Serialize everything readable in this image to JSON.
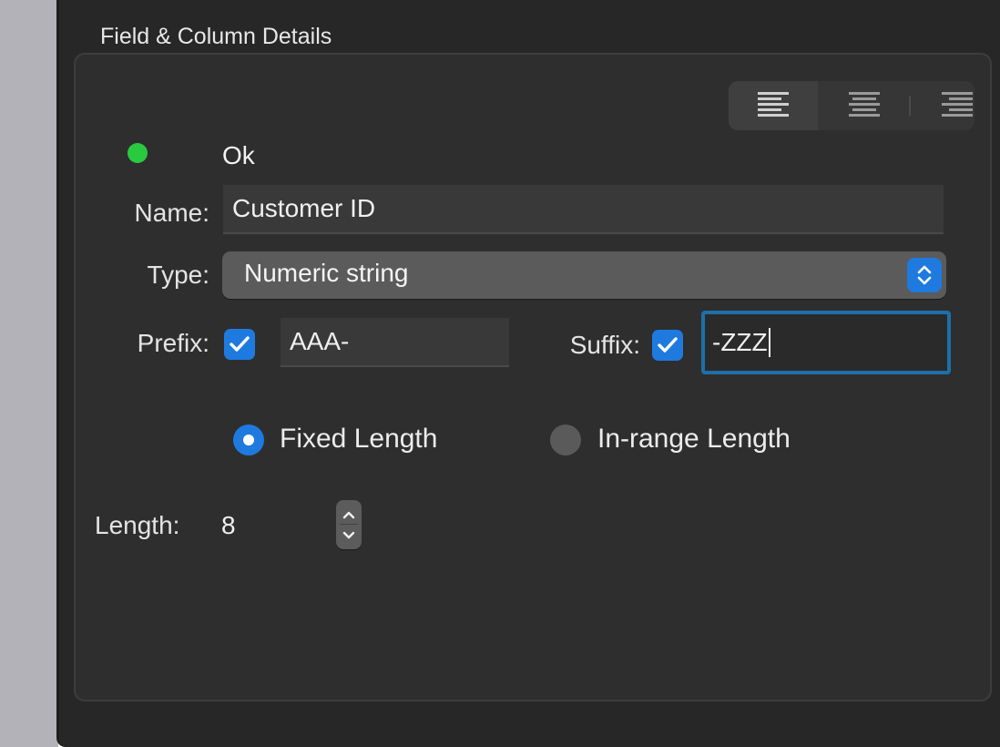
{
  "panel": {
    "title": "Field & Column Details"
  },
  "alignment": {
    "options": [
      "align-left",
      "align-center",
      "align-right"
    ],
    "selected": "align-left"
  },
  "status": {
    "color": "#29c940",
    "text": "Ok"
  },
  "name_field": {
    "label": "Name:",
    "value": "Customer ID"
  },
  "type_field": {
    "label": "Type:",
    "value": "Numeric string",
    "icon": "chevron-up-down-icon"
  },
  "prefix": {
    "label": "Prefix:",
    "checked": true,
    "value": "AAA-"
  },
  "suffix": {
    "label": "Suffix:",
    "checked": true,
    "value": "-ZZZ"
  },
  "length_mode": {
    "options": [
      {
        "label": "Fixed Length",
        "selected": true
      },
      {
        "label": "In-range Length",
        "selected": false
      }
    ]
  },
  "length": {
    "label": "Length:",
    "value": "8"
  },
  "colors": {
    "accent": "#1f7ae0",
    "focus_ring": "#1f6fa8",
    "background": "#272727"
  }
}
